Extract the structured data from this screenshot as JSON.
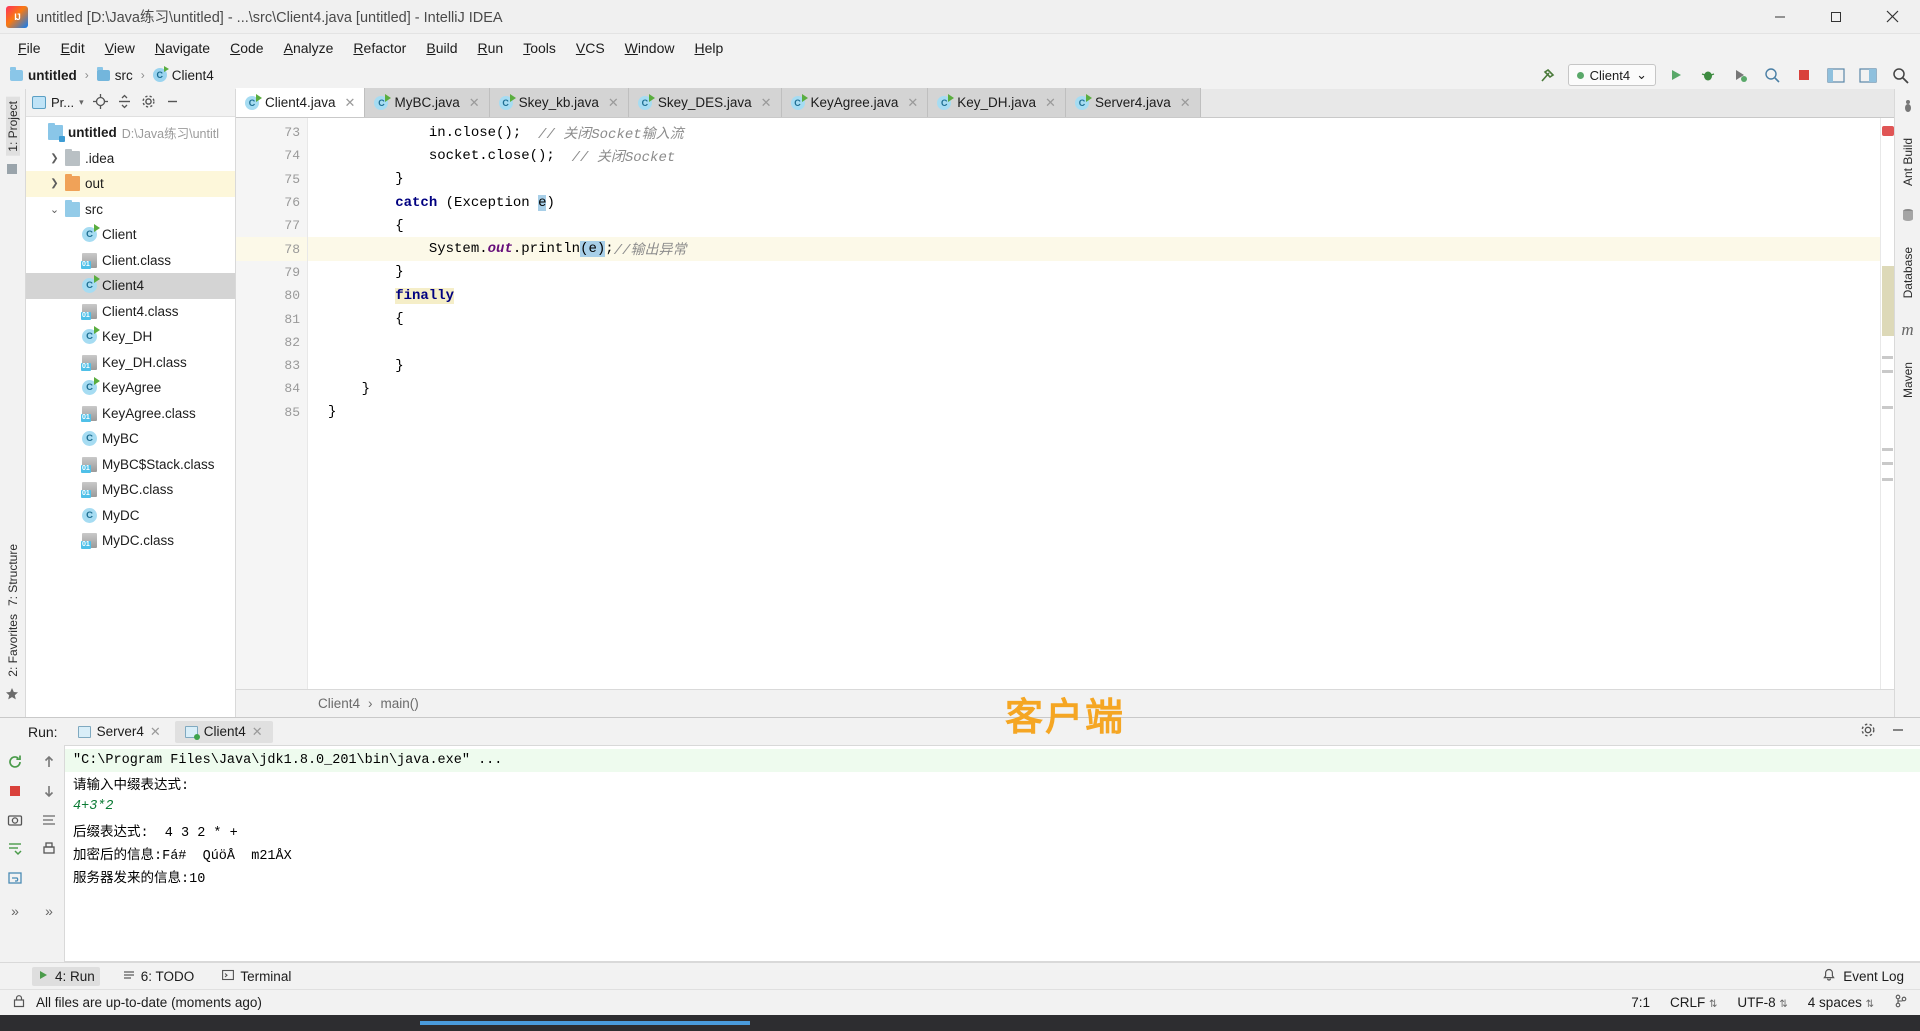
{
  "window": {
    "title": "untitled [D:\\Java练习\\untitled] - ...\\src\\Client4.java [untitled] - IntelliJ IDEA",
    "minimize_label": "—",
    "maximize_label": "□",
    "close_label": "✕"
  },
  "menu": {
    "items": [
      "File",
      "Edit",
      "View",
      "Navigate",
      "Code",
      "Analyze",
      "Refactor",
      "Build",
      "Run",
      "Tools",
      "VCS",
      "Window",
      "Help"
    ]
  },
  "navbar": {
    "breadcrumbs": [
      "untitled",
      "src",
      "Client4"
    ],
    "run_config": "Client4",
    "run_config_caret": "⌄",
    "icons": [
      "hammer-icon",
      "run-icon",
      "debug-icon",
      "coverage-icon",
      "profile-icon",
      "stop-icon",
      "settings-ui-icon",
      "layout-icon",
      "search-icon"
    ]
  },
  "left_strip": {
    "project_label": "1: Project",
    "structure_label": "7: Structure",
    "favorites_label": "2: Favorites"
  },
  "right_strip": {
    "ant_label": "Ant Build",
    "database_label": "Database",
    "maven_label": "Maven"
  },
  "project_panel": {
    "header_title": "Pr...",
    "header_icons": [
      "project-view-icon",
      "locate-icon",
      "collapse-all-icon",
      "settings-icon",
      "hide-icon"
    ],
    "tree": [
      {
        "label": "untitled",
        "suffix": "D:\\Java练习\\untitl",
        "icon": "module-folder-icon",
        "indent": 0,
        "chevron": "",
        "state": "normal",
        "bold": true
      },
      {
        "label": ".idea",
        "suffix": "",
        "icon": "folder-icon-gray",
        "indent": 1,
        "chevron": "›",
        "state": "normal",
        "bold": false
      },
      {
        "label": "out",
        "suffix": "",
        "icon": "folder-icon-orange",
        "indent": 1,
        "chevron": "›",
        "state": "highlight",
        "bold": false
      },
      {
        "label": "src",
        "suffix": "",
        "icon": "folder-icon-blue",
        "indent": 1,
        "chevron": "⌄",
        "state": "normal",
        "bold": false
      },
      {
        "label": "Client",
        "suffix": "",
        "icon": "java-class-runnable-icon",
        "indent": 2,
        "chevron": "",
        "state": "normal",
        "bold": false
      },
      {
        "label": "Client.class",
        "suffix": "",
        "icon": "compiled-class-icon",
        "indent": 2,
        "chevron": "",
        "state": "normal",
        "bold": false
      },
      {
        "label": "Client4",
        "suffix": "",
        "icon": "java-class-runnable-icon",
        "indent": 2,
        "chevron": "",
        "state": "selected",
        "bold": false
      },
      {
        "label": "Client4.class",
        "suffix": "",
        "icon": "compiled-class-icon",
        "indent": 2,
        "chevron": "",
        "state": "normal",
        "bold": false
      },
      {
        "label": "Key_DH",
        "suffix": "",
        "icon": "java-class-runnable-icon",
        "indent": 2,
        "chevron": "",
        "state": "normal",
        "bold": false
      },
      {
        "label": "Key_DH.class",
        "suffix": "",
        "icon": "compiled-class-icon",
        "indent": 2,
        "chevron": "",
        "state": "normal",
        "bold": false
      },
      {
        "label": "KeyAgree",
        "suffix": "",
        "icon": "java-class-runnable-icon",
        "indent": 2,
        "chevron": "",
        "state": "normal",
        "bold": false
      },
      {
        "label": "KeyAgree.class",
        "suffix": "",
        "icon": "compiled-class-icon",
        "indent": 2,
        "chevron": "",
        "state": "normal",
        "bold": false
      },
      {
        "label": "MyBC",
        "suffix": "",
        "icon": "java-class-icon",
        "indent": 2,
        "chevron": "",
        "state": "normal",
        "bold": false
      },
      {
        "label": "MyBC$Stack.class",
        "suffix": "",
        "icon": "compiled-class-icon",
        "indent": 2,
        "chevron": "",
        "state": "normal",
        "bold": false
      },
      {
        "label": "MyBC.class",
        "suffix": "",
        "icon": "compiled-class-icon",
        "indent": 2,
        "chevron": "",
        "state": "normal",
        "bold": false
      },
      {
        "label": "MyDC",
        "suffix": "",
        "icon": "java-class-icon",
        "indent": 2,
        "chevron": "",
        "state": "normal",
        "bold": false
      },
      {
        "label": "MyDC.class",
        "suffix": "",
        "icon": "compiled-class-icon",
        "indent": 2,
        "chevron": "",
        "state": "normal",
        "bold": false
      }
    ]
  },
  "editor": {
    "tabs": [
      {
        "label": "Client4.java",
        "active": true
      },
      {
        "label": "MyBC.java",
        "active": false
      },
      {
        "label": "Skey_kb.java",
        "active": false
      },
      {
        "label": "Skey_DES.java",
        "active": false
      },
      {
        "label": "KeyAgree.java",
        "active": false
      },
      {
        "label": "Key_DH.java",
        "active": false
      },
      {
        "label": "Server4.java",
        "active": false
      }
    ],
    "tab_close": "✕",
    "lines": [
      {
        "num": "73",
        "fold": "",
        "current": false,
        "parts": [
          {
            "t": "            in.close();  ",
            "c": "plain"
          },
          {
            "t": "// 关闭Socket输入流",
            "c": "cmt"
          }
        ]
      },
      {
        "num": "74",
        "fold": "",
        "current": false,
        "parts": [
          {
            "t": "            socket.close();  ",
            "c": "plain"
          },
          {
            "t": "// 关闭Socket",
            "c": "cmt"
          }
        ]
      },
      {
        "num": "75",
        "fold": "−",
        "current": false,
        "parts": [
          {
            "t": "        }",
            "c": "plain"
          }
        ]
      },
      {
        "num": "76",
        "fold": "",
        "current": false,
        "parts": [
          {
            "t": "        ",
            "c": "plain"
          },
          {
            "t": "catch",
            "c": "kw"
          },
          {
            "t": " (Exception ",
            "c": "plain"
          },
          {
            "t": "e",
            "c": "sel"
          },
          {
            "t": ")",
            "c": "plain"
          }
        ]
      },
      {
        "num": "77",
        "fold": "−",
        "current": false,
        "parts": [
          {
            "t": "        {",
            "c": "plain"
          }
        ]
      },
      {
        "num": "78",
        "fold": "",
        "current": true,
        "parts": [
          {
            "t": "            System.",
            "c": "plain"
          },
          {
            "t": "out",
            "c": "fld"
          },
          {
            "t": ".println",
            "c": "plain"
          },
          {
            "t": "(e)",
            "c": "sel"
          },
          {
            "t": ";",
            "c": "plain"
          },
          {
            "t": "//输出异常",
            "c": "cmt"
          }
        ]
      },
      {
        "num": "79",
        "fold": "−",
        "current": false,
        "parts": [
          {
            "t": "        }",
            "c": "plain"
          }
        ]
      },
      {
        "num": "80",
        "fold": "",
        "current": false,
        "parts": [
          {
            "t": "        ",
            "c": "plain"
          },
          {
            "t": "finally",
            "c": "kwhl"
          }
        ]
      },
      {
        "num": "81",
        "fold": "",
        "current": false,
        "parts": [
          {
            "t": "        {",
            "c": "plain"
          }
        ]
      },
      {
        "num": "82",
        "fold": "",
        "current": false,
        "parts": [
          {
            "t": "",
            "c": "plain"
          }
        ]
      },
      {
        "num": "83",
        "fold": "",
        "current": false,
        "parts": [
          {
            "t": "        }",
            "c": "plain"
          }
        ]
      },
      {
        "num": "84",
        "fold": "−",
        "current": false,
        "parts": [
          {
            "t": "    }",
            "c": "plain"
          }
        ]
      },
      {
        "num": "85",
        "fold": "",
        "current": false,
        "parts": [
          {
            "t": "}",
            "c": "plain"
          }
        ]
      }
    ],
    "breadcrumb": [
      "Client4",
      "main()"
    ],
    "breadcrumb_sep": "›",
    "watermark": "客户端",
    "error_marker_color": "#e05555"
  },
  "run_panel": {
    "title": "Run:",
    "tabs": [
      {
        "label": "Server4",
        "active": false,
        "running": false
      },
      {
        "label": "Client4",
        "active": true,
        "running": true
      }
    ],
    "tab_close": "✕",
    "side_buttons": [
      "rerun-icon",
      "stop-icon",
      "up-arrow-icon",
      "down-arrow-icon",
      "camera-icon",
      "wrap-icon",
      "print-icon",
      "scroll-end-icon",
      "soft-wrap-icon",
      "expand-icon"
    ],
    "header_right_icons": [
      "settings-icon",
      "minimize-icon"
    ],
    "output": [
      {
        "text": "\"C:\\Program Files\\Java\\jdk1.8.0_201\\bin\\java.exe\" ...",
        "style": "cmd"
      },
      {
        "text": "请输入中缀表达式:",
        "style": "normal"
      },
      {
        "text": "4+3*2",
        "style": "input"
      },
      {
        "text": "后缀表达式:  4 3 2 * +",
        "style": "normal"
      },
      {
        "text": "加密后的信息:Fá#  QúöÅ  m21ÅX",
        "style": "normal"
      },
      {
        "text": "服务器发来的信息:10",
        "style": "normal"
      }
    ]
  },
  "bottom_bar": {
    "tabs": [
      {
        "label": "4: Run",
        "icon": "run-icon",
        "selected": true
      },
      {
        "label": "6: TODO",
        "icon": "todo-icon",
        "selected": false
      },
      {
        "label": "Terminal",
        "icon": "terminal-icon",
        "selected": false
      }
    ],
    "event_log": "Event Log",
    "event_log_icon": "bell-icon"
  },
  "status_bar": {
    "message": "All files are up-to-date (moments ago)",
    "caret_position": "7:1",
    "line_separator": "CRLF",
    "encoding": "UTF-8",
    "indent": "4 spaces",
    "lock_icon": "lock-icon",
    "caret_glyph": "⇅"
  }
}
